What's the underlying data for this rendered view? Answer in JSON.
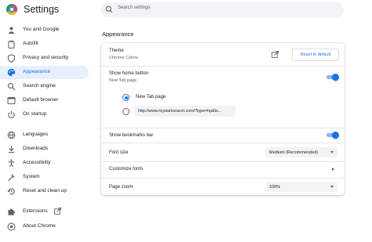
{
  "header": {
    "title": "Settings",
    "search_placeholder": "Search settings"
  },
  "sidebar": {
    "items": [
      {
        "label": "You and Google",
        "icon": "person-icon"
      },
      {
        "label": "Autofill",
        "icon": "clipboard-icon"
      },
      {
        "label": "Privacy and security",
        "icon": "shield-icon"
      },
      {
        "label": "Appearance",
        "icon": "palette-icon",
        "active": true
      },
      {
        "label": "Search engine",
        "icon": "search-icon"
      },
      {
        "label": "Default browser",
        "icon": "browser-icon"
      },
      {
        "label": "On startup",
        "icon": "power-icon"
      },
      {
        "label": "Languages",
        "icon": "globe-icon"
      },
      {
        "label": "Downloads",
        "icon": "download-icon"
      },
      {
        "label": "Accessibility",
        "icon": "accessibility-icon"
      },
      {
        "label": "System",
        "icon": "wrench-icon"
      },
      {
        "label": "Reset and clean up",
        "icon": "history-icon"
      },
      {
        "label": "Extensions",
        "icon": "puzzle-icon"
      },
      {
        "label": "About Chrome",
        "icon": "chrome-icon"
      }
    ]
  },
  "main": {
    "section_title": "Appearance",
    "theme": {
      "label": "Theme",
      "value": "Chrome Colors",
      "reset_label": "Reset to default"
    },
    "home_button": {
      "label": "Show home button",
      "sub": "New Tab page",
      "enabled": true,
      "options": [
        {
          "label": "New Tab page",
          "selected": true
        },
        {
          "label": "http://www.mystartsearch.com/?type=hp&ts...",
          "selected": false
        }
      ]
    },
    "bookmarks_bar": {
      "label": "Show bookmarks bar",
      "enabled": true
    },
    "font_size": {
      "label": "Font size",
      "value": "Medium (Recommended)"
    },
    "customize_fonts": {
      "label": "Customize fonts"
    },
    "page_zoom": {
      "label": "Page zoom",
      "value": "100%"
    }
  },
  "colors": {
    "accent": "#1a73e8",
    "active_bg": "#e8f0fe",
    "toggle_track": "#8ab4f8"
  }
}
